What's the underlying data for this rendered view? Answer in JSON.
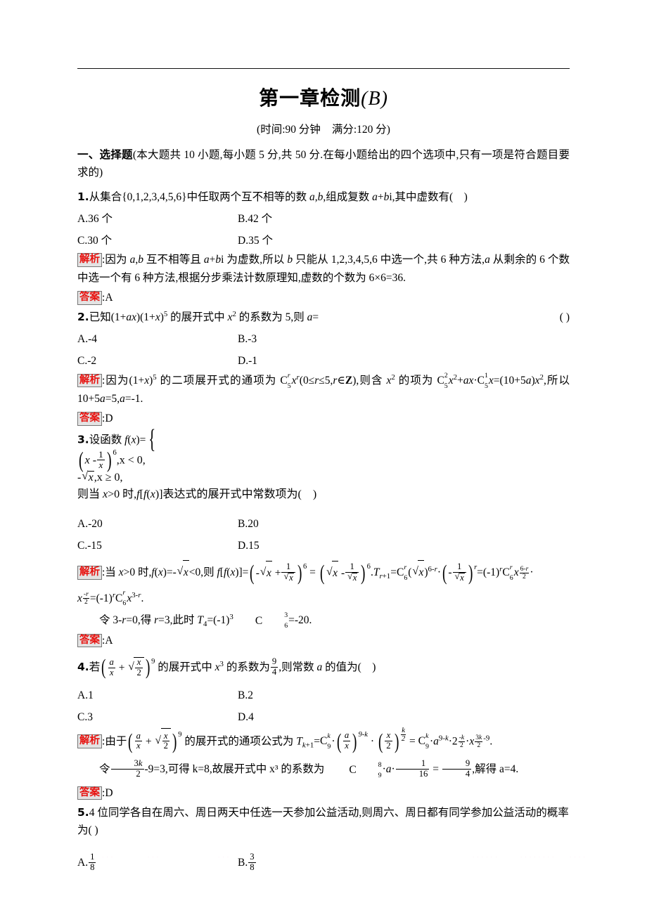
{
  "header": {
    "title_main": "第一章检测",
    "title_paren_open": "(",
    "title_letter": "B",
    "title_paren_close": ")",
    "subtitle_time": "(时间:90 分钟",
    "subtitle_score": "满分:120 分)"
  },
  "section": {
    "label": "一、选择题",
    "description": "(本大题共 10 小题,每小题 5 分,共 50 分.在每小题给出的四个选项中,只有一项是符合题目要求的)"
  },
  "questions": [
    {
      "number": "1.",
      "stem": "从集合 {0,1,2,3,4,5,6} 中任取两个互不相等的数 a,b,组成复数 a+bi,其中虚数有(    )",
      "stem_plain": "从集合{0,1,2,3,4,5,6}中任取两个互不相等的数",
      "options": [
        {
          "key": "A.",
          "text": "36 个"
        },
        {
          "key": "B.",
          "text": "42 个"
        },
        {
          "key": "C.",
          "text": "30 个"
        },
        {
          "key": "D.",
          "text": "35 个"
        }
      ],
      "analysis_tag": "解析",
      "analysis_text": "因为 a,b 互不相等且 a+bi 为虚数,所以 b 只能从 1,2,3,4,5,6 中选一个,共 6 种方法,a 从剩余的 6 个数中选一个有 6 种方法,根据分步乘法计数原理知,虚数的个数为 6×6=36.",
      "answer_tag": "答案",
      "answer": "A"
    },
    {
      "number": "2.",
      "stem": "已知(1+ax)(1+x)⁵ 的展开式中 x² 的系数为 5,则 a=",
      "trailing_paren": "(    )",
      "options": [
        {
          "key": "A.",
          "text": "-4"
        },
        {
          "key": "B.",
          "text": "-3"
        },
        {
          "key": "C.",
          "text": "-2"
        },
        {
          "key": "D.",
          "text": "-1"
        }
      ],
      "analysis_tag": "解析",
      "analysis_text": "因为(1+x)⁵ 的二项展开式的通项为 C₅ʳxʳ(0≤r≤5,r∈Z),则含 x² 的项为 C₅²x²+ax·C₅¹x=(10+5a)x²,所以 10+5a=5,a=-1.",
      "answer_tag": "答案",
      "answer": "D"
    },
    {
      "number": "3.",
      "stem_pre": "设函数 f(x)=",
      "case_1": ",x < 0,",
      "case_2": ",x ≥ 0,",
      "stem_post": "则当 x>0 时,f[f(x)]表达式的展开式中常数项为(    )",
      "options": [
        {
          "key": "A.",
          "text": "-20"
        },
        {
          "key": "B.",
          "text": "20"
        },
        {
          "key": "C.",
          "text": "-15"
        },
        {
          "key": "D.",
          "text": "15"
        }
      ],
      "analysis_tag": "解析",
      "analysis_line2_prefix": "令 3-r=0,得 r=3,此时 T₄=(-1)³C₆³=-20.",
      "answer_tag": "答案",
      "answer": "A"
    },
    {
      "number": "4.",
      "stem_pre": "若",
      "stem_post": "的展开式中 x³ 的系数为",
      "stem_tail": "则常数 a 的值为(    )",
      "coef_num": "9",
      "coef_den": "4",
      "options": [
        {
          "key": "A.",
          "text": "1"
        },
        {
          "key": "B.",
          "text": "2"
        },
        {
          "key": "C.",
          "text": "3"
        },
        {
          "key": "D.",
          "text": "4"
        }
      ],
      "analysis_tag": "解析",
      "analysis_line1_pre": "由于",
      "analysis_line1_mid": "的展开式的通项公式为",
      "analysis_line2_pre": "令",
      "analysis_line2_mid": "-9=3,可得 k=8,故展开式中 x³ 的系数为",
      "analysis_line2_tail": ",解得 a=4.",
      "answer_tag": "答案",
      "answer": "D"
    },
    {
      "number": "5.",
      "stem": "4 位同学各自在周六、周日两天中任选一天参加公益活动,则周六、周日都有同学参加公益活动的概率为(    )",
      "options": [
        {
          "key": "A.",
          "num": "1",
          "den": "8"
        },
        {
          "key": "B.",
          "num": "3",
          "den": "8"
        }
      ]
    }
  ],
  "colors": {
    "tag_text": "#e8120f",
    "tag_bg": "#e3e3e3",
    "tag_border": "#777777",
    "text": "#000000"
  }
}
